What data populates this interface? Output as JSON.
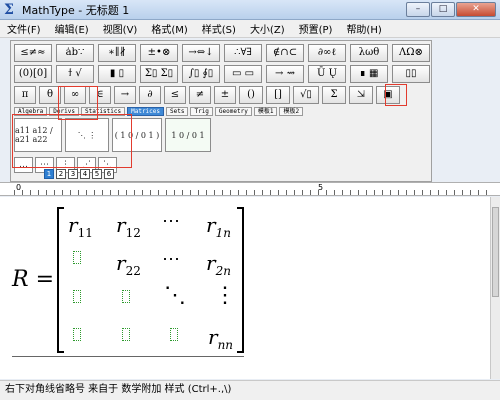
{
  "window": {
    "title": "MathType - 无标题 1",
    "controls": [
      "–",
      "□",
      "✕"
    ]
  },
  "menu": [
    "文件(F)",
    "编辑(E)",
    "视图(V)",
    "格式(M)",
    "样式(S)",
    "大小(Z)",
    "预置(P)",
    "帮助(H)"
  ],
  "palette": {
    "row1": [
      "≤≠≈",
      "ȧb∵",
      "∗∥∦",
      "±•⊗",
      "→⇔↓",
      "∴∀∃",
      "∉∩⊂",
      "∂∞ℓ",
      "λωθ",
      "ΛΩ⊗"
    ],
    "row2": [
      "(0)[0]",
      "ϯ √",
      "▮ ▯",
      "Σ▯ Σ▯",
      "∫▯ ∮▯",
      "▭ ▭",
      "→ ⇝",
      "Ū Ų",
      "∎ ▦",
      "▯▯"
    ],
    "row3": [
      "π",
      "θ",
      "∞",
      "∈",
      "→",
      "∂",
      "≤",
      "≠",
      "±",
      "()",
      "[]",
      "√▯",
      "Σ",
      "⇲",
      "▣"
    ],
    "tabs": [
      "Algebra",
      "Derivs",
      "Statistics",
      "Matrices",
      "Sets",
      "Trig",
      "Geometry",
      "模板1",
      "模板2"
    ],
    "active_tab": "Matrices",
    "templates": [
      "a11 a12 / a21 a22",
      "⋱ ⋮",
      "( 1 0 / 0 1 )",
      "1 0 / 0 1"
    ],
    "dot_buttons": [
      "…",
      "⋯",
      "⋮",
      "⋰",
      "⋱"
    ],
    "mini_buttons": [
      "1",
      "2",
      "3",
      "4",
      "5",
      "6"
    ]
  },
  "ruler": {
    "label_0": "0",
    "label_5": "5"
  },
  "equation": {
    "lhs": "R",
    "eq": "=",
    "r11": "r",
    "r11_sub": "11",
    "r12": "r",
    "r12_sub": "12",
    "r1n": "r",
    "r1n_sub": "1n",
    "r22": "r",
    "r22_sub": "22",
    "r2n": "r",
    "r2n_sub": "2n",
    "rnn": "r",
    "rnn_sub": "nn",
    "hdots": "⋯",
    "vdots": "⋮",
    "ddots": "⋱"
  },
  "status": "右下对角线省略号 来自于 数学附加 样式 (Ctrl+.,\\)"
}
